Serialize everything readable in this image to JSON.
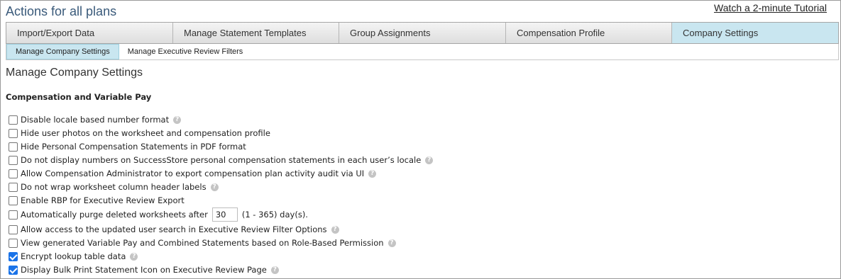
{
  "header": {
    "title": "Actions for all plans",
    "tutorial_link": "Watch a 2-minute Tutorial"
  },
  "tabs": [
    {
      "label": "Import/Export Data",
      "active": false
    },
    {
      "label": "Manage Statement Templates",
      "active": false
    },
    {
      "label": "Group Assignments",
      "active": false
    },
    {
      "label": "Compensation Profile",
      "active": false
    },
    {
      "label": "Company Settings",
      "active": true
    }
  ],
  "subtabs": [
    {
      "label": "Manage Company Settings",
      "active": true
    },
    {
      "label": "Manage Executive Review Filters",
      "active": false
    }
  ],
  "section": {
    "title": "Manage Company Settings",
    "group_title": "Compensation and Variable Pay"
  },
  "options": [
    {
      "label": "Disable locale based number format",
      "checked": false,
      "help": true
    },
    {
      "label": "Hide user photos on the worksheet and compensation profile",
      "checked": false,
      "help": false
    },
    {
      "label": "Hide Personal Compensation Statements in PDF format",
      "checked": false,
      "help": false
    },
    {
      "label": "Do not display numbers on SuccessStore personal compensation statements in each user’s locale",
      "checked": false,
      "help": true
    },
    {
      "label": "Allow Compensation Administrator to export compensation plan activity audit via UI",
      "checked": false,
      "help": true
    },
    {
      "label": "Do not wrap worksheet column header labels",
      "checked": false,
      "help": true
    },
    {
      "label": "Enable RBP for Executive Review Export",
      "checked": false,
      "help": false
    },
    {
      "label": "Automatically purge deleted worksheets after",
      "checked": false,
      "help": false,
      "input_value": "30",
      "suffix": "(1 - 365) day(s)."
    },
    {
      "label": "Allow access to the updated user search in Executive Review Filter Options",
      "checked": false,
      "help": true
    },
    {
      "label": "View generated Variable Pay and Combined Statements based on Role-Based Permission",
      "checked": false,
      "help": true
    },
    {
      "label": "Encrypt lookup table data",
      "checked": true,
      "help": true
    },
    {
      "label": "Display Bulk Print Statement Icon on Executive Review Page",
      "checked": true,
      "help": true
    }
  ],
  "icons": {
    "help": "help-icon",
    "help_glyph": "?"
  },
  "colors": {
    "active_tab": "#c9e6f0",
    "checkbox_checked": "#1a73e8",
    "title": "#3a5a7a"
  }
}
